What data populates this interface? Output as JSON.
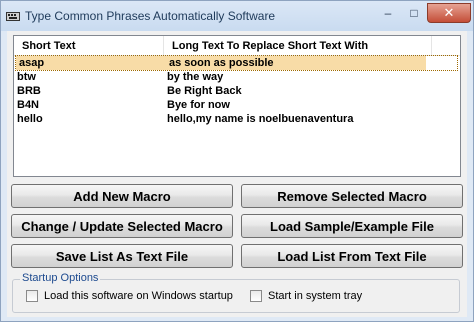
{
  "window": {
    "title": "Type Common Phrases Automatically Software",
    "icon": "app-icon"
  },
  "title_controls": {
    "minimize": "–",
    "maximize": "□",
    "close": "✕"
  },
  "list": {
    "columns": [
      "Short Text",
      "Long Text To Replace Short Text With"
    ],
    "rows": [
      {
        "short": "asap",
        "long": "as soon as possible",
        "selected": true
      },
      {
        "short": "btw",
        "long": "by the way",
        "selected": false
      },
      {
        "short": "BRB",
        "long": "Be Right Back",
        "selected": false
      },
      {
        "short": "B4N",
        "long": "Bye for now",
        "selected": false
      },
      {
        "short": "hello",
        "long": "hello,my name is noelbuenaventura",
        "selected": false
      }
    ]
  },
  "buttons": {
    "add_new_macro": "Add New Macro",
    "remove_selected_macro": "Remove Selected Macro",
    "change_update_macro": "Change / Update Selected Macro",
    "load_sample": "Load Sample/Example File",
    "save_list": "Save List As Text File",
    "load_list": "Load List From Text File"
  },
  "startup_options": {
    "legend": "Startup Options",
    "load_on_startup": "Load this software on Windows startup",
    "start_in_tray": "Start in system tray"
  },
  "colors": {
    "selection": "#f8dca7",
    "legend_text": "#1d4a8f",
    "close_button": "#c44e38"
  }
}
